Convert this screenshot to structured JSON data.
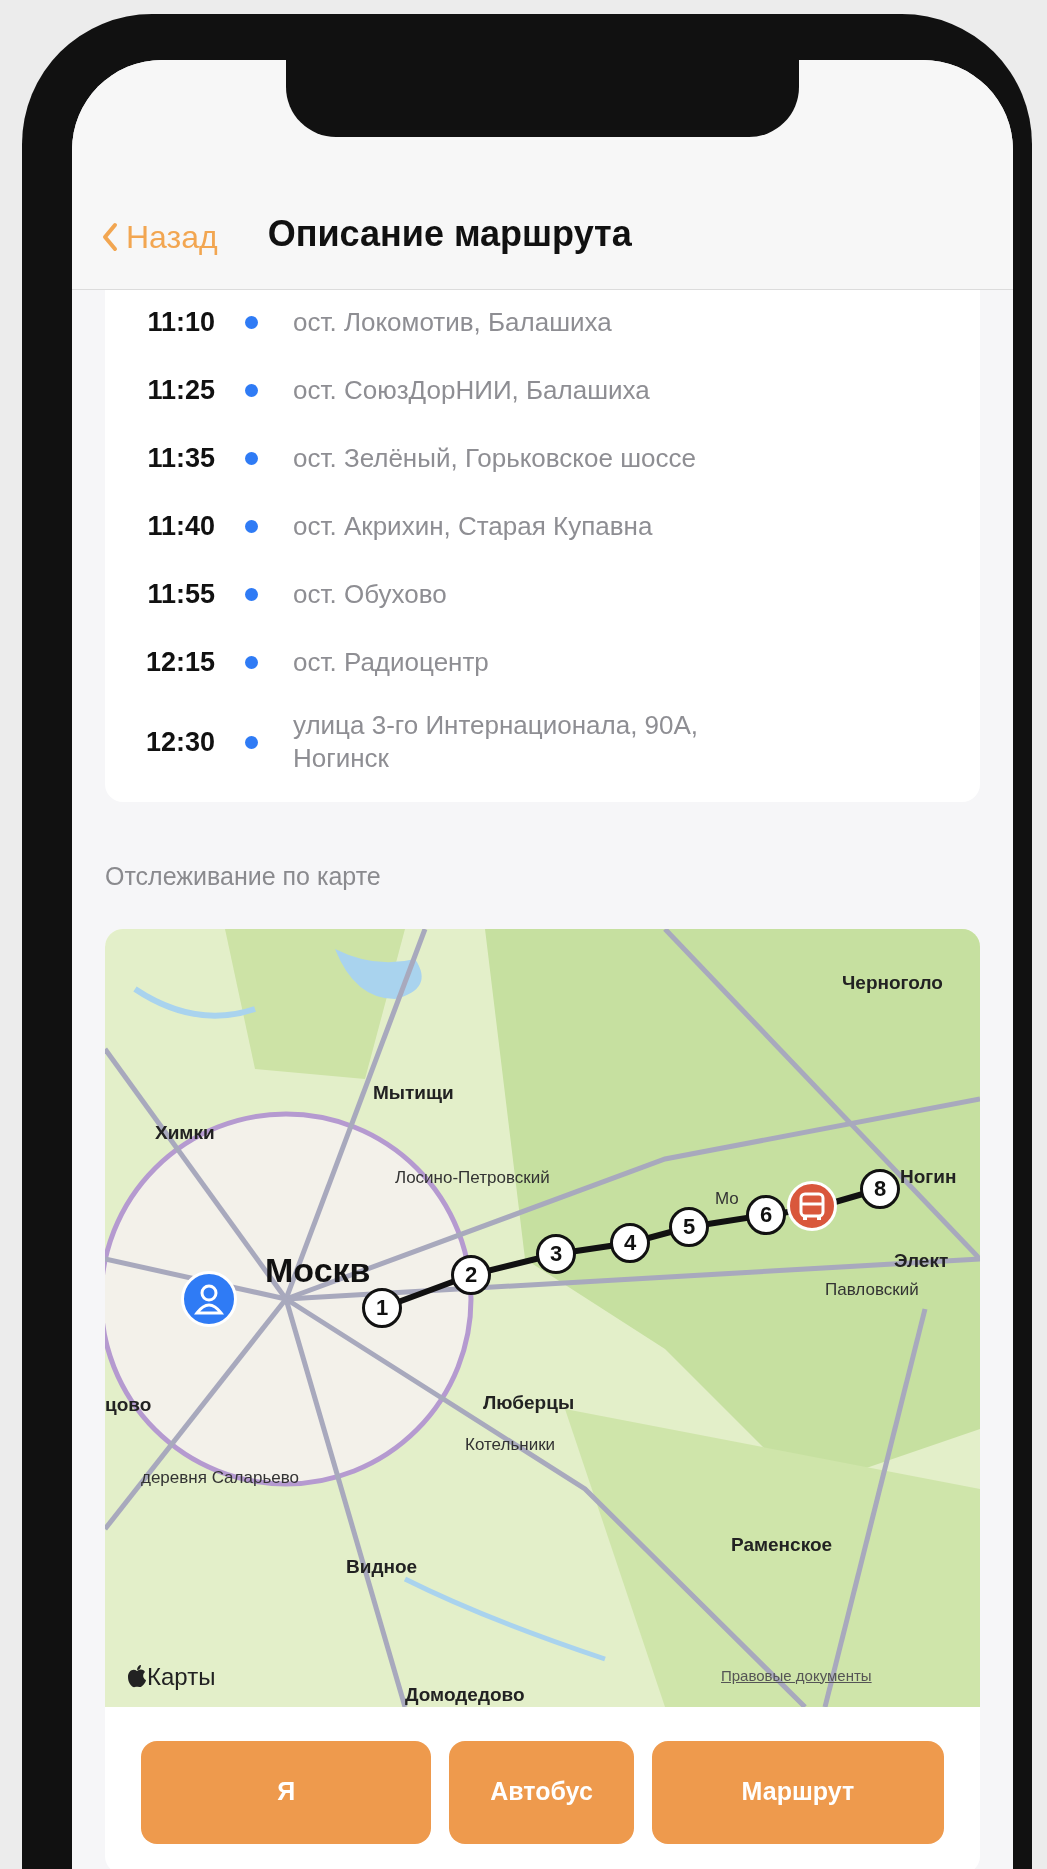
{
  "nav": {
    "back": "Назад",
    "title": "Описание маршрута"
  },
  "stops": [
    {
      "time": "11:10",
      "place": "ост. Локомотив, Балашиха"
    },
    {
      "time": "11:25",
      "place": "ост. СоюзДорНИИ, Балашиха"
    },
    {
      "time": "11:35",
      "place": "ост. Зелёный, Горьковское шоссе"
    },
    {
      "time": "11:40",
      "place": "ост. Акрихин, Старая Купавна"
    },
    {
      "time": "11:55",
      "place": "ост. Обухово"
    },
    {
      "time": "12:15",
      "place": "ост. Радиоцентр"
    },
    {
      "time": "12:30",
      "place": "улица 3-го Интернационала, 90А, Ногинск"
    }
  ],
  "map_section": {
    "heading": "Отслеживание по карте",
    "map": {
      "labels": [
        {
          "text": "Черноголо",
          "kind": "city"
        },
        {
          "text": "Мытищи",
          "kind": "city"
        },
        {
          "text": "Химки",
          "kind": "city"
        },
        {
          "text": "Лосино-Петровский",
          "kind": "town"
        },
        {
          "text": "Мо",
          "kind": "town"
        },
        {
          "text": "Ногин",
          "kind": "city"
        },
        {
          "text": "Элект",
          "kind": "city"
        },
        {
          "text": "Павловский",
          "kind": "town"
        },
        {
          "text": "Москв",
          "kind": "capital"
        },
        {
          "text": "цово",
          "kind": "city"
        },
        {
          "text": "Люберцы",
          "kind": "city"
        },
        {
          "text": "Котельники",
          "kind": "town"
        },
        {
          "text": "деревня Саларьево",
          "kind": "town"
        },
        {
          "text": "Раменское",
          "kind": "city"
        },
        {
          "text": "Видное",
          "kind": "city"
        },
        {
          "text": "Домодедово",
          "kind": "city"
        }
      ],
      "route_markers": [
        "1",
        "2",
        "3",
        "4",
        "5",
        "6",
        "8"
      ],
      "attribution": "Карты",
      "legal_link": "Правовые документы"
    },
    "buttons": [
      "Я",
      "Автобус",
      "Маршрут"
    ]
  }
}
